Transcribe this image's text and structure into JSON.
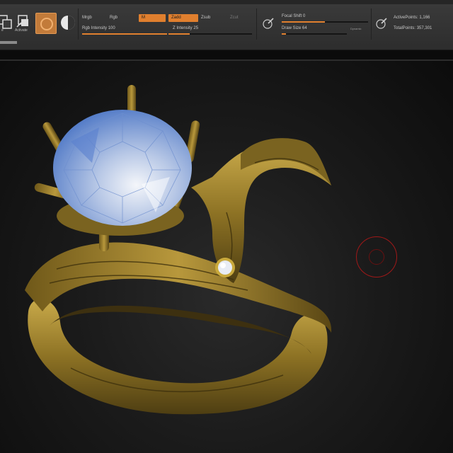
{
  "toolbar": {
    "icon_labels": {
      "left_cut": "e",
      "activate": "Activate"
    },
    "mrgb": "Mrgb",
    "rgb": "Rgb",
    "m": "M",
    "zadd": "Zadd",
    "zsub": "Zsub",
    "zcut": "Zcut",
    "rgb_intensity": {
      "label": "Rgb Intensity",
      "value": "100",
      "level": 1.0
    },
    "z_intensity": {
      "label": "Z Intensity",
      "value": "25",
      "level": 0.25
    },
    "focal_shift": {
      "label": "Focal Shift",
      "value": "0",
      "level": 0.5
    },
    "draw_size": {
      "label": "Draw Size",
      "value": "64",
      "level": 0.06
    },
    "dynamic": "Dynamic",
    "active_points": {
      "label": "ActivePoints:",
      "value": "1,166"
    },
    "total_points": {
      "label": "TotalPoints:",
      "value": "357,301"
    }
  },
  "colors": {
    "accent": "#e07f2e",
    "gold": "#a8892a",
    "gem": "#9fb8e6",
    "brush_ring": "#a01818"
  },
  "icons": [
    "cut-icon",
    "activate-icon",
    "material-icon",
    "sphere-icon",
    "draw-pencil-icon",
    "point-pencil-icon"
  ]
}
